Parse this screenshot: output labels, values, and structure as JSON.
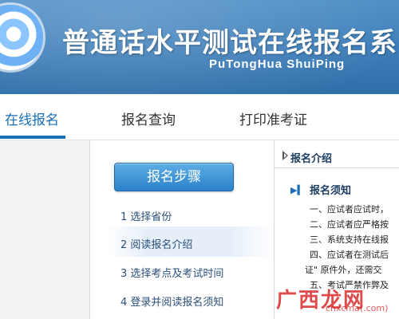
{
  "header": {
    "title": "普通话水平测试在线报名系",
    "subtitle": "PuTongHua ShuiPing"
  },
  "nav": {
    "tabs": [
      {
        "label": "在线报名",
        "active": true
      },
      {
        "label": "报名查询",
        "active": false
      },
      {
        "label": "打印准考证",
        "active": false
      }
    ]
  },
  "steps": {
    "button_label": "报名步骤",
    "items": [
      {
        "label": "1 选择省份"
      },
      {
        "label": "2 阅读报名介绍",
        "highlighted": true
      },
      {
        "label": "3 选择考点及考试时间"
      },
      {
        "label": "4 登录并阅读报名须知"
      }
    ]
  },
  "content": {
    "section_title": "报名介绍",
    "notice_title": "报名须知",
    "rules": [
      "一、应试者应试时，",
      "二、应试者应严格按",
      "三、系统支持在线报",
      "四、应试者在测试后",
      "证\" 原件外，还需交",
      "五、考试严禁作弊及"
    ]
  },
  "watermark": {
    "main": "广西龙网",
    "small": "cnxcma(.com)"
  },
  "colors": {
    "banner": "#3d7db8",
    "accent": "#1a6fb6",
    "watermark": "#d72323"
  }
}
